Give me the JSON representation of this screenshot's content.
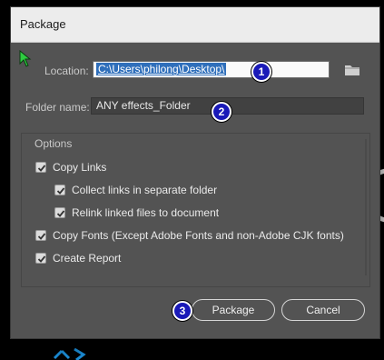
{
  "dialog": {
    "title": "Package",
    "location_label": "Location:",
    "location_value": "C:\\Users\\philong\\Desktop\\",
    "folder_name_label": "Folder name:",
    "folder_name_value": "ANY effects_Folder",
    "options_heading": "Options",
    "options": [
      {
        "label": "Copy Links",
        "checked": true
      },
      {
        "label": "Collect links in separate folder",
        "checked": true
      },
      {
        "label": "Relink linked files to document",
        "checked": true
      },
      {
        "label": "Copy Fonts (Except Adobe Fonts and non-Adobe CJK fonts)",
        "checked": true
      },
      {
        "label": "Create Report",
        "checked": true
      }
    ],
    "package_button": "Package",
    "cancel_button": "Cancel"
  },
  "annotations": [
    "1",
    "2",
    "3"
  ],
  "icons": {
    "folder": "folder-icon",
    "check": "checkmark-icon",
    "cursor": "mouse-pointer-icon"
  },
  "colors": {
    "dialog_bg": "#535353",
    "title_bar": "#ececec",
    "selection": "#2f6fbb",
    "badge": "#1a1ab8",
    "cursor": "#2ecc40"
  }
}
